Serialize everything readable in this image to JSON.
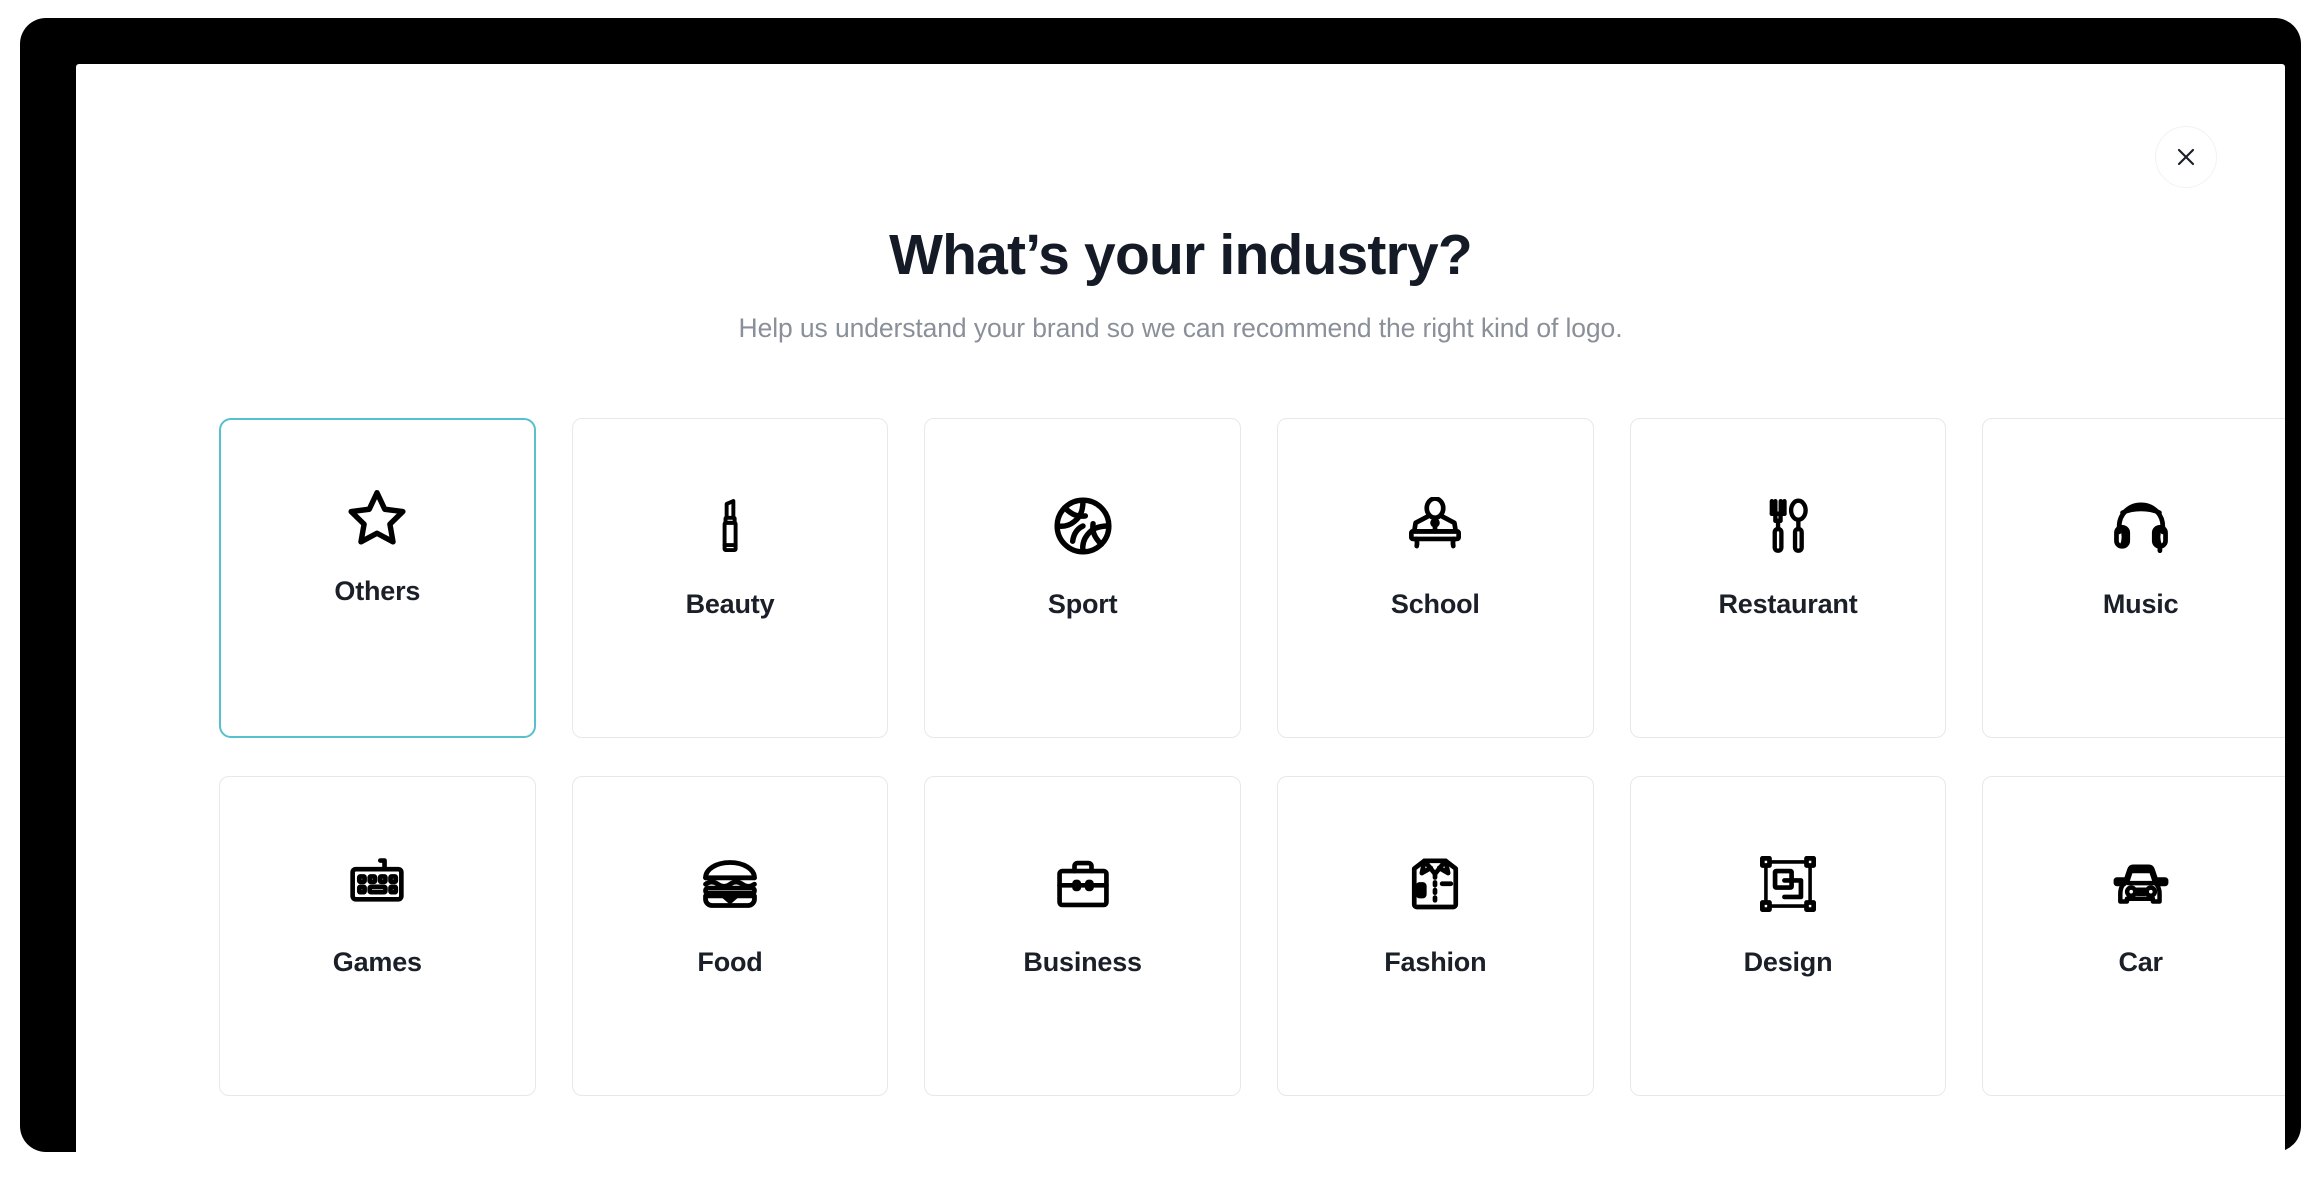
{
  "window": {
    "close_button_label": "×",
    "close_icon": "close-icon"
  },
  "header": {
    "title": "What’s your industry?",
    "subtitle": "Help us understand your brand so we can recommend the right kind of logo."
  },
  "theme": {
    "accent_color": "#56c0cc",
    "card_border_color": "#e6e8ec",
    "title_color": "#151b26",
    "subtitle_color": "#8a9099",
    "label_color": "#1a1f28",
    "bezel_color": "#000000",
    "background_color": "#ffffff"
  },
  "grid": {
    "columns": 6,
    "rows": 2,
    "selected_index": 0,
    "items": [
      {
        "label": "Others",
        "icon": "star-icon",
        "selected": true
      },
      {
        "label": "Beauty",
        "icon": "lipstick-icon",
        "selected": false
      },
      {
        "label": "Sport",
        "icon": "basketball-icon",
        "selected": false
      },
      {
        "label": "School",
        "icon": "lectern-icon",
        "selected": false
      },
      {
        "label": "Restaurant",
        "icon": "cutlery-icon",
        "selected": false
      },
      {
        "label": "Music",
        "icon": "headphones-icon",
        "selected": false
      },
      {
        "label": "Games",
        "icon": "keyboard-icon",
        "selected": false
      },
      {
        "label": "Food",
        "icon": "burger-icon",
        "selected": false
      },
      {
        "label": "Business",
        "icon": "briefcase-icon",
        "selected": false
      },
      {
        "label": "Fashion",
        "icon": "shirt-icon",
        "selected": false
      },
      {
        "label": "Design",
        "icon": "shapes-icon",
        "selected": false
      },
      {
        "label": "Car",
        "icon": "car-icon",
        "selected": false
      }
    ]
  }
}
